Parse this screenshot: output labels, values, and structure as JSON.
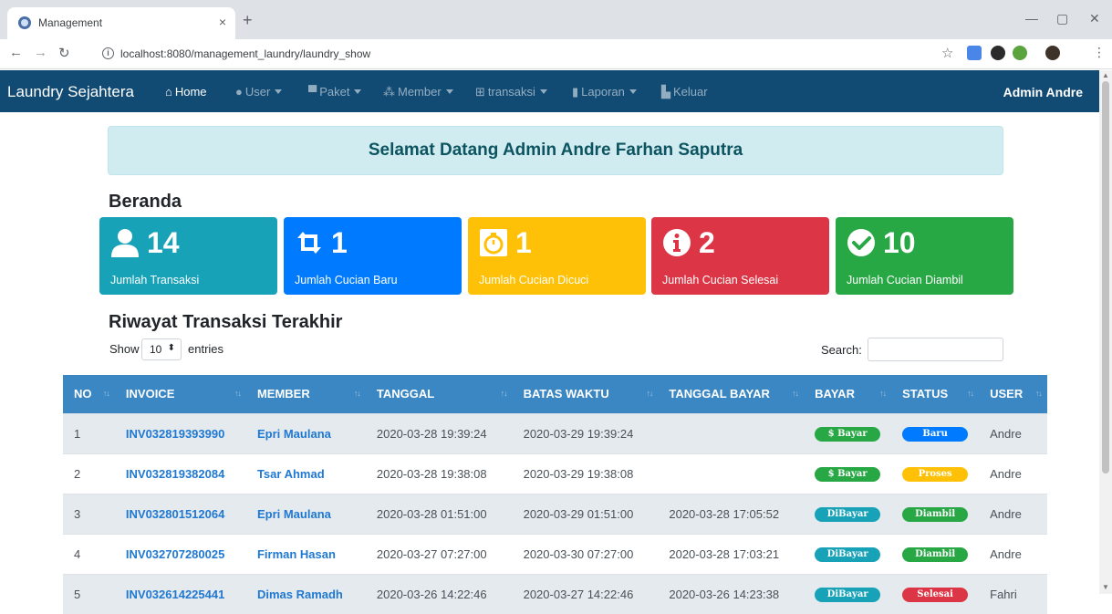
{
  "browser": {
    "tab_title": "Management",
    "tab_close": "×",
    "new_tab": "+",
    "url": "localhost:8080/management_laundry/laundry_show",
    "window_controls": {
      "minimize": "—",
      "restore": "▢",
      "close": "✕"
    }
  },
  "navbar": {
    "brand": "Laundry Sejahtera",
    "items": [
      {
        "label": "Home",
        "icon": "home-icon",
        "dropdown": false
      },
      {
        "label": "User",
        "icon": "user-icon",
        "dropdown": true
      },
      {
        "label": "Paket",
        "icon": "box-icon",
        "dropdown": true
      },
      {
        "label": "Member",
        "icon": "users-icon",
        "dropdown": true
      },
      {
        "label": "transaksi",
        "icon": "cart-icon",
        "dropdown": true
      },
      {
        "label": "Laporan",
        "icon": "file-icon",
        "dropdown": true
      },
      {
        "label": "Keluar",
        "icon": "door-icon",
        "dropdown": false
      }
    ],
    "admin": "Admin Andre"
  },
  "welcome": "Selamat Datang Admin Andre Farhan Saputra",
  "page_heading": "Beranda",
  "cards": [
    {
      "count": "14",
      "label": "Jumlah Transaksi",
      "icon": "user-icon",
      "color": "#17a2b8"
    },
    {
      "count": "1",
      "label": "Jumlah Cucian Baru",
      "icon": "retweet-icon",
      "color": "#007bff"
    },
    {
      "count": "1",
      "label": "Jumlah Cucian Dicuci",
      "icon": "stopwatch-icon",
      "color": "#ffc107"
    },
    {
      "count": "2",
      "label": "Jumlah Cucian Selesai",
      "icon": "info-circle-icon",
      "color": "#dc3545"
    },
    {
      "count": "10",
      "label": "Jumlah Cucian Diambil",
      "icon": "check-circle-icon",
      "color": "#28a745"
    }
  ],
  "recent": {
    "heading": "Riwayat Transaksi Terakhir",
    "show_label": "Show",
    "entries_value": "10",
    "entries_label": "entries",
    "search_label": "Search:",
    "columns": [
      "NO",
      "INVOICE",
      "MEMBER",
      "TANGGAL",
      "BATAS WAKTU",
      "TANGGAL BAYAR",
      "BAYAR",
      "STATUS",
      "USER"
    ],
    "rows": [
      {
        "no": "1",
        "invoice": "INV032819393990",
        "member": "Epri Maulana",
        "tanggal": "2020-03-28 19:39:24",
        "batas": "2020-03-29 19:39:24",
        "bayar_tgl": "",
        "bayar": "$ Bayar",
        "status": "Baru",
        "user": "Andre"
      },
      {
        "no": "2",
        "invoice": "INV032819382084",
        "member": "Tsar Ahmad",
        "tanggal": "2020-03-28 19:38:08",
        "batas": "2020-03-29 19:38:08",
        "bayar_tgl": "",
        "bayar": "$ Bayar",
        "status": "Proses",
        "user": "Andre"
      },
      {
        "no": "3",
        "invoice": "INV032801512064",
        "member": "Epri Maulana",
        "tanggal": "2020-03-28 01:51:00",
        "batas": "2020-03-29 01:51:00",
        "bayar_tgl": "2020-03-28 17:05:52",
        "bayar": "DiBayar",
        "status": "Diambil",
        "user": "Andre"
      },
      {
        "no": "4",
        "invoice": "INV032707280025",
        "member": "Firman Hasan",
        "tanggal": "2020-03-27 07:27:00",
        "batas": "2020-03-30 07:27:00",
        "bayar_tgl": "2020-03-28 17:03:21",
        "bayar": "DiBayar",
        "status": "Diambil",
        "user": "Andre"
      },
      {
        "no": "5",
        "invoice": "INV032614225441",
        "member": "Dimas Ramadh",
        "tanggal": "2020-03-26 14:22:46",
        "batas": "2020-03-27 14:22:46",
        "bayar_tgl": "2020-03-26 14:23:38",
        "bayar": "DiBayar",
        "status": "Selesai",
        "user": "Fahri"
      }
    ]
  },
  "colors": {
    "navbar": "#114a73",
    "table_header": "#3a87c4",
    "pill_bayar": "#28a745",
    "pill_dibayar": "#17a2b8",
    "status_baru": "#007bff",
    "status_proses": "#ffc107",
    "status_diambil": "#28a745",
    "status_selesai": "#dc3545"
  }
}
